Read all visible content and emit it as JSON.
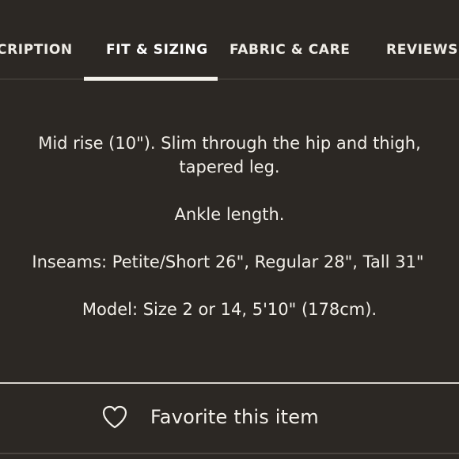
{
  "tabs": [
    {
      "label": "CRIPTION",
      "active": false
    },
    {
      "label": "FIT & SIZING",
      "active": true
    },
    {
      "label": "FABRIC & CARE",
      "active": false
    },
    {
      "label": "REVIEWS",
      "active": false
    }
  ],
  "fit_panel": {
    "rise_line1": "Mid rise (10\"). Slim through the hip and thigh,",
    "rise_line2": "tapered leg.",
    "length": "Ankle length.",
    "inseams": "Inseams: Petite/Short 26\", Regular 28\", Tall 31\"",
    "model": "Model: Size 2 or 14, 5'10\" (178cm)."
  },
  "favorite": {
    "icon": "heart-outline-icon",
    "label": "Favorite this item"
  },
  "colors": {
    "background": "#2c2824",
    "text": "#f2efe9",
    "active_indicator": "#f3f0ea"
  }
}
